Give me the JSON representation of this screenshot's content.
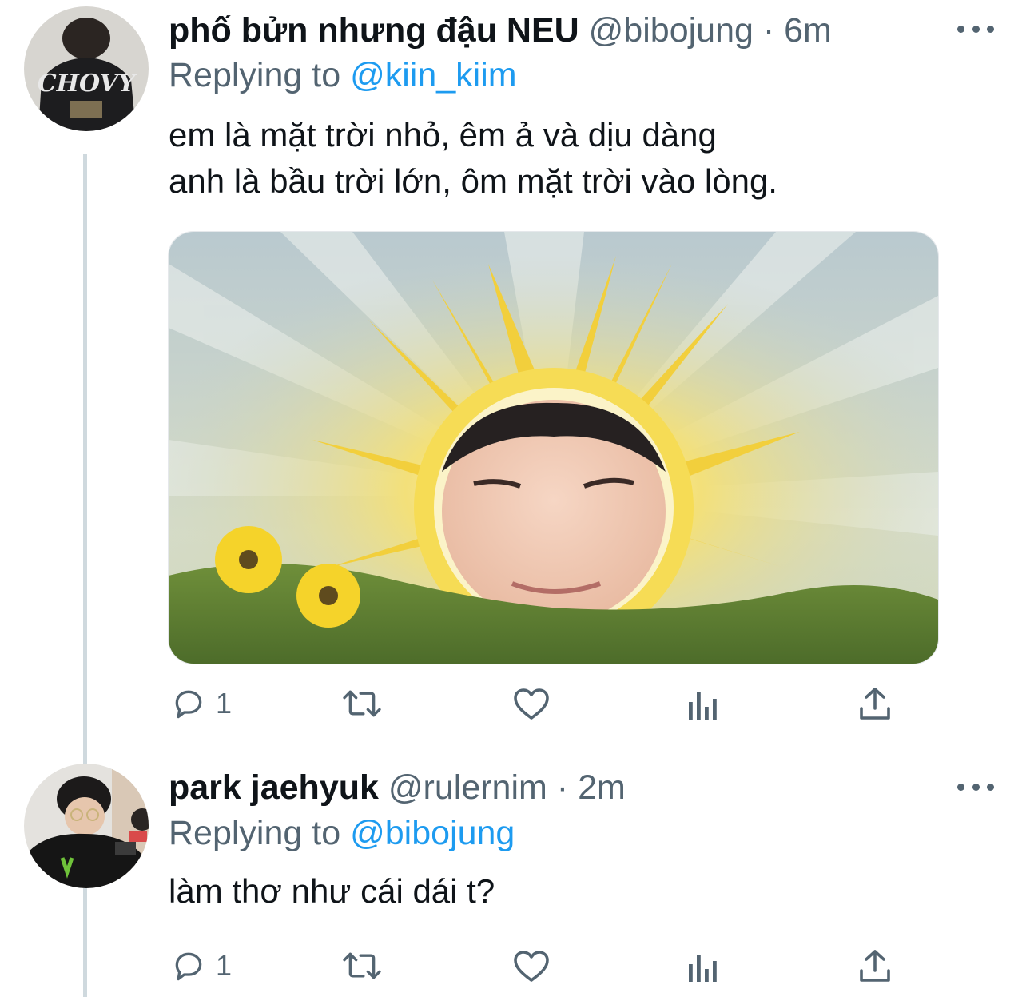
{
  "tweets": [
    {
      "display_name": "phố bửn nhưng đậu NEU",
      "handle": "@bibojung",
      "separator": "·",
      "time": "6m",
      "replying_prefix": "Replying to",
      "replying_to": "@kiin_kiim",
      "text_line1": "em là mặt trời nhỏ, êm ả và dịu dàng",
      "text_line2": "anh là bầu trời lớn, ôm mặt trời vào lòng.",
      "avatar_text": "CHOVY",
      "reply_count": "1"
    },
    {
      "display_name": "park jaehyuk",
      "handle": "@rulernim",
      "separator": "·",
      "time": "2m",
      "replying_prefix": "Replying to",
      "replying_to": "@bibojung",
      "text_line1": "làm thơ như cái dái t?",
      "reply_count": "1"
    }
  ],
  "colors": {
    "link": "#1d9bf0",
    "secondary_text": "#536471",
    "thread_line": "#cfd9de"
  },
  "icons": [
    "reply-icon",
    "retweet-icon",
    "like-icon",
    "analytics-icon",
    "share-icon",
    "more-icon"
  ]
}
